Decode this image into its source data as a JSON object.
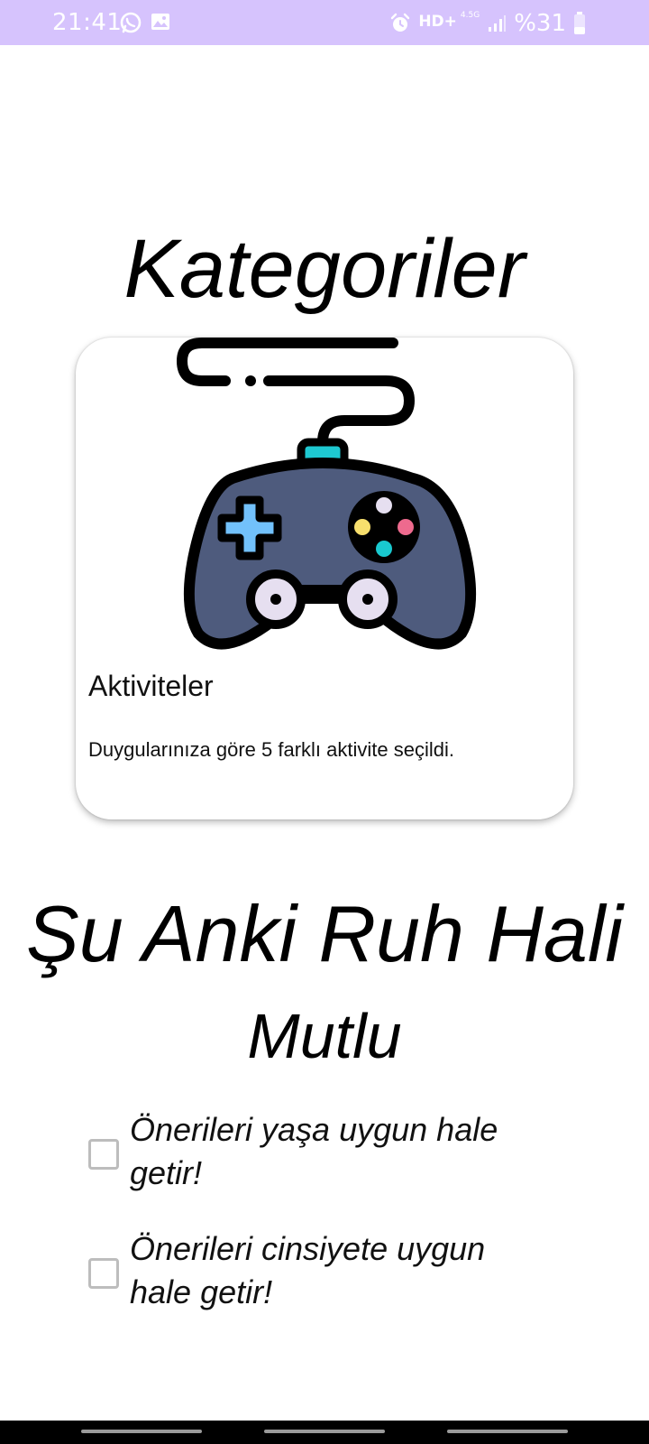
{
  "status_bar": {
    "time": "21:41",
    "left_icons": [
      "whatsapp-icon",
      "gallery-icon"
    ],
    "alarm_icon": "alarm-icon",
    "network": "HD+",
    "network_small": "4.5G",
    "signal_icon": "signal-icon",
    "battery": "%31",
    "battery_icon": "battery-icon",
    "background_color": "#d6c3fd"
  },
  "main": {
    "categories_title": "Kategoriler",
    "card": {
      "illustration": "gamepad-icon",
      "title": "Aktiviteler",
      "description": "Duygularınıza göre 5 farklı aktivite seçildi."
    },
    "mood_title": "Şu Anki Ruh Hali",
    "mood_value": "Mutlu",
    "options": [
      {
        "label": "Önerileri yaşa uygun hale getir!",
        "checked": false
      },
      {
        "label": "Önerileri cinsiyete uygun hale getir!",
        "checked": false
      }
    ]
  },
  "colors": {
    "gamepad_body": "#4e5b7d",
    "gamepad_outline": "#000000",
    "dpad": "#72c1fb",
    "connector": "#1ec9d2",
    "button_yellow": "#f7df6d",
    "button_pink": "#ee6a8e",
    "button_cyan": "#19c9cf",
    "button_white": "#e6dff0",
    "stick": "#e6dff0"
  }
}
